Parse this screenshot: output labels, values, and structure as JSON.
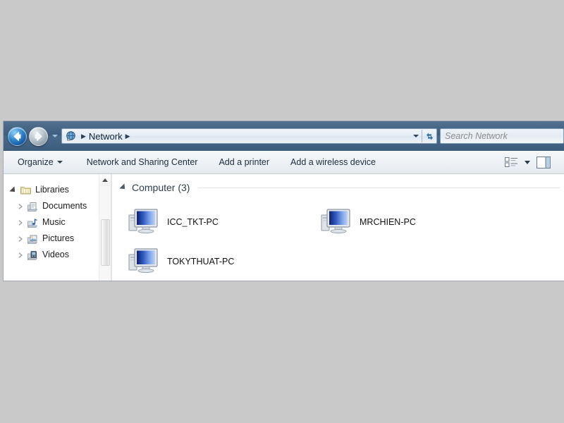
{
  "window": {
    "addressbar": {
      "back_tooltip": "Back",
      "forward_tooltip": "Forward",
      "breadcrumb_icon": "network-globe-icon",
      "crumb_separator_1": "▶",
      "crumb_label": "Network",
      "crumb_separator_2": "▶",
      "refresh_icon": "refresh-icon"
    },
    "search": {
      "placeholder": "Search Network",
      "value": ""
    },
    "toolbar": {
      "organize_label": "Organize",
      "network_sharing_label": "Network and Sharing Center",
      "add_printer_label": "Add a printer",
      "add_wireless_label": "Add a wireless device",
      "change_view_icon": "change-view-icon",
      "preview_pane_icon": "preview-pane-icon"
    },
    "navpane": {
      "items": [
        {
          "label": "Libraries",
          "icon": "libraries-folder-icon",
          "expanded": true,
          "level": 0
        },
        {
          "label": "Documents",
          "icon": "documents-library-icon",
          "expanded": false,
          "level": 1
        },
        {
          "label": "Music",
          "icon": "music-library-icon",
          "expanded": false,
          "level": 1
        },
        {
          "label": "Pictures",
          "icon": "pictures-library-icon",
          "expanded": false,
          "level": 1
        },
        {
          "label": "Videos",
          "icon": "videos-library-icon",
          "expanded": false,
          "level": 1
        }
      ]
    },
    "content": {
      "group_title": "Computer (3)",
      "items": [
        {
          "label": "ICC_TKT-PC",
          "icon": "computer-icon"
        },
        {
          "label": "MRCHIEN-PC",
          "icon": "computer-icon"
        },
        {
          "label": "TOKYTHUAT-PC",
          "icon": "computer-icon"
        }
      ]
    }
  },
  "colors": {
    "desktop_background": "#c9c9c9",
    "addressbar_blue": "#44607f",
    "toolbar_grey": "#eef2f6",
    "content_white": "#ffffff",
    "group_header_text": "#2c3e50",
    "monitor_screen_blue": "#2a4fb0"
  }
}
